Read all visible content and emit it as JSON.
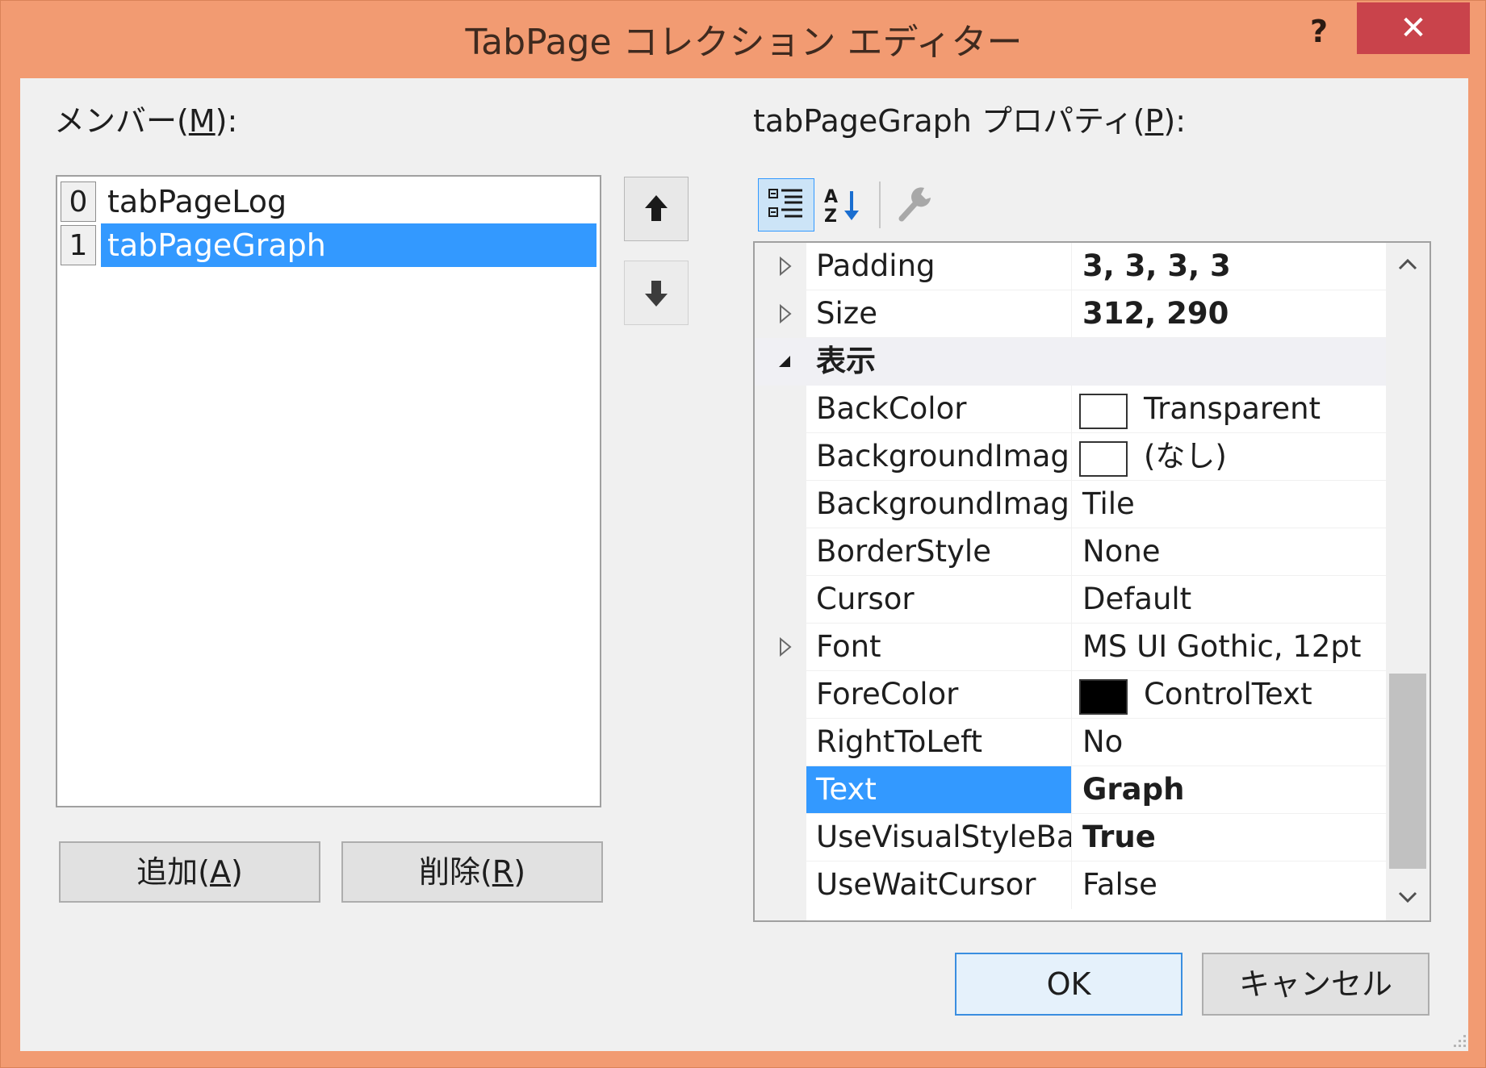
{
  "window": {
    "title": "TabPage コレクション エディター",
    "help_label": "?",
    "close_label": "✕"
  },
  "members": {
    "label_prefix": "メンバー(",
    "label_mnemonic": "M",
    "label_suffix": "):",
    "items": [
      {
        "index": "0",
        "name": "tabPageLog"
      },
      {
        "index": "1",
        "name": "tabPageGraph"
      }
    ],
    "selected_index": 1,
    "up_icon": "arrow-up-icon",
    "down_icon": "arrow-down-icon",
    "add_prefix": "追加(",
    "add_mnemonic": "A",
    "add_suffix": ")",
    "remove_prefix": "削除(",
    "remove_mnemonic": "R",
    "remove_suffix": ")"
  },
  "properties": {
    "label_prefix": "tabPageGraph プロパティ(",
    "label_mnemonic": "P",
    "label_suffix": "):",
    "toolbar": [
      "categorized-icon",
      "alphabetical-sort-icon",
      "property-pages-icon"
    ],
    "rows": [
      {
        "name": "Padding",
        "value": "3, 3, 3, 3",
        "expander": "collapsed",
        "bold_value": true
      },
      {
        "name": "Size",
        "value": "312, 290",
        "expander": "collapsed",
        "bold_value": true
      },
      {
        "name": "表示",
        "category": true,
        "expander": "expanded"
      },
      {
        "name": "BackColor",
        "value": "Transparent",
        "swatch": "white"
      },
      {
        "name": "BackgroundImag",
        "value": "(なし)",
        "swatch": "white"
      },
      {
        "name": "BackgroundImag",
        "value": "Tile"
      },
      {
        "name": "BorderStyle",
        "value": "None"
      },
      {
        "name": "Cursor",
        "value": "Default"
      },
      {
        "name": "Font",
        "value": "MS UI Gothic, 12pt",
        "expander": "collapsed"
      },
      {
        "name": "ForeColor",
        "value": "ControlText",
        "swatch": "black"
      },
      {
        "name": "RightToLeft",
        "value": "No"
      },
      {
        "name": "Text",
        "value": "Graph",
        "bold_value": true,
        "selected": true
      },
      {
        "name": "UseVisualStyleBa",
        "value": "True",
        "bold_value": true
      },
      {
        "name": "UseWaitCursor",
        "value": "False"
      }
    ]
  },
  "buttons": {
    "ok": "OK",
    "cancel": "キャンセル"
  },
  "colors": {
    "frame": "#f29b72",
    "close": "#c9434b",
    "selection": "#3399ff",
    "client": "#f0f0f0"
  }
}
